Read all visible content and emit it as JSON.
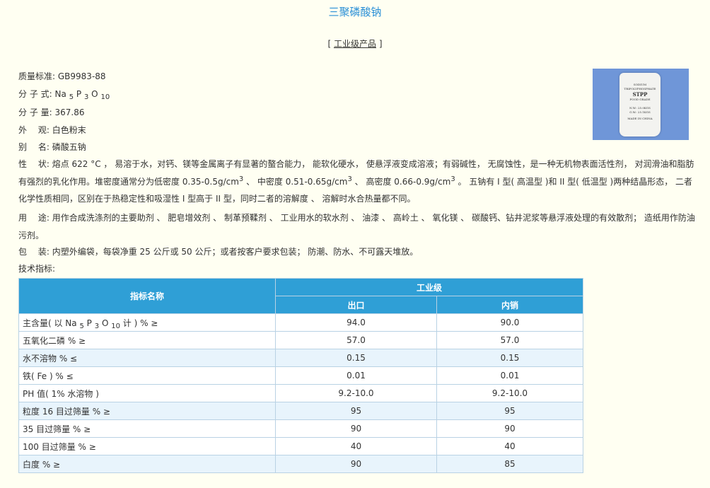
{
  "page": {
    "title": "三聚磷酸钠",
    "category_bracket_open": "[",
    "category_label": "工业级产品",
    "category_bracket_close": "]"
  },
  "product_image": {
    "lines": [
      "SODIUM TRIPOLYPHOSPHATE",
      "STPP",
      "FOOD GRADE",
      "N.W.: 25.0KGS",
      "G.W.: 25.1KGS",
      "MADE IN CHINA"
    ]
  },
  "info": {
    "standard": {
      "label": "质量标准:",
      "value": "GB9983-88"
    },
    "formula": {
      "label": "分 子 式:",
      "parts": [
        "Na",
        "5",
        "P",
        "3",
        "O",
        "10"
      ]
    },
    "weight": {
      "label": "分 子 量:",
      "value": "367.86"
    },
    "appearance": {
      "label": "外　 观:",
      "value": "白色粉末"
    },
    "alias": {
      "label": "别　 名:",
      "value": "磷酸五钠"
    },
    "properties": {
      "label": "性　 状:",
      "text_1": "熔点 622 °C ， 易溶于水，对钙、镁等金属离子有显著的螯合能力， 能软化硬水， 使悬浮液变成溶液；有弱碱性， 无腐蚀性，是一种无机物表面活性剂， 对润滑油和脂肪有强烈的乳化作用。堆密度通常分为低密度 0.35-0.5g/cm",
      "sup_1": "3",
      "text_2": " 、 中密度 0.51-0.65g/cm",
      "sup_2": "3",
      "text_3": " 、 高密度 0.66-0.9g/cm",
      "sup_3": "3",
      "text_4": " 。 五钠有 I 型( 高温型 )和 II 型( 低温型 )两种结晶形态， 二者化学性质相同，区别在于热稳定性和吸湿性 I 型高于 II 型，同时二者的溶解度 、 溶解时水合热量都不同。"
    },
    "usage": {
      "label": "用　 途:",
      "value": "用作合成洗涤剂的主要助剂 、 肥皂增效剂 、 制革预鞣剂 、 工业用水的软水剂 、 油漆 、 高岭土 、 氧化镁 、 碳酸钙、钻井泥浆等悬浮液处理的有效散剂； 造纸用作防油污剂。"
    },
    "packaging": {
      "label": "包　 装:",
      "value": "内塑外编袋，每袋净重 25 公斤或 50 公斤；或者按客户要求包装； 防潮、防水、不可露天堆放。"
    },
    "tech_label": "技术指标:"
  },
  "table": {
    "header_name": "指标名称",
    "header_group": "工业级",
    "header_export": "出口",
    "header_domestic": "内销",
    "first_row": {
      "prefix": "主含量( 以 Na",
      "sub1": "5",
      "mid1": " P",
      "sub2": "3",
      "mid2": " O",
      "sub3": "10",
      "suffix": " 计 ) % ≥",
      "export": "94.0",
      "domestic": "90.0"
    },
    "rows": [
      {
        "name": "五氧化二磷 % ≥",
        "export": "57.0",
        "domestic": "57.0"
      },
      {
        "name": "水不溶物 % ≤",
        "export": "0.15",
        "domestic": "0.15"
      },
      {
        "name": "铁( Fe ) % ≤",
        "export": "0.01",
        "domestic": "0.01"
      },
      {
        "name": "PH 值( 1% 水溶物 )",
        "export": "9.2-10.0",
        "domestic": "9.2-10.0"
      },
      {
        "name": "粒度 16 目过筛量 % ≥",
        "export": "95",
        "domestic": "95"
      },
      {
        "name": "35 目过筛量 % ≥",
        "export": "90",
        "domestic": "90"
      },
      {
        "name": "100 目过筛量 % ≥",
        "export": "40",
        "domestic": "40"
      },
      {
        "name": "白度 % ≥",
        "export": "90",
        "domestic": "85"
      }
    ]
  }
}
